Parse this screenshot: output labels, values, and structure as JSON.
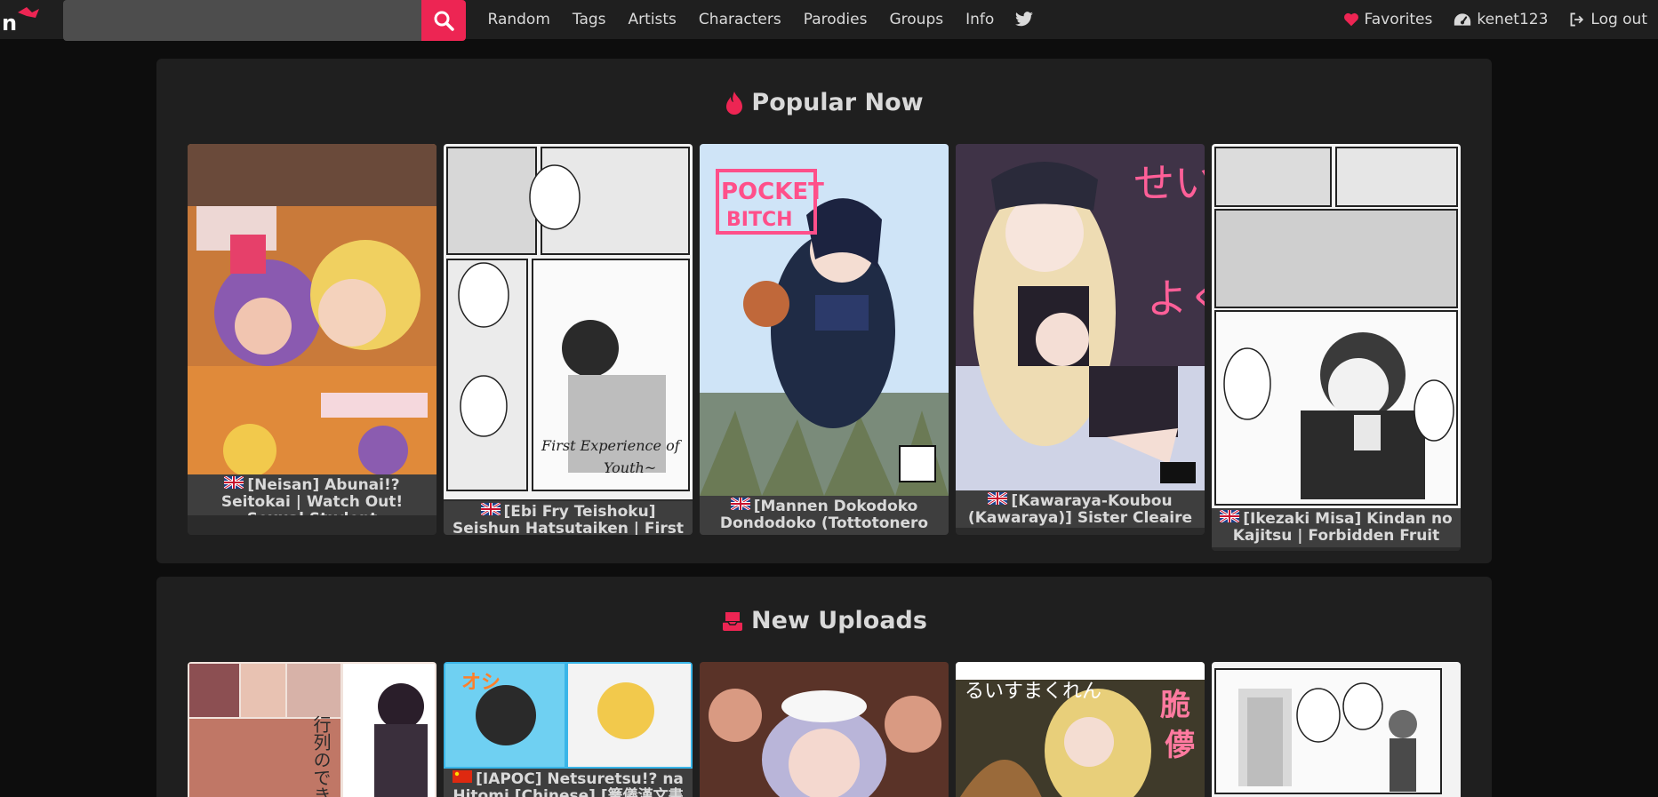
{
  "nav": {
    "logo_letter": "n",
    "search": {
      "value": "",
      "placeholder": ""
    },
    "links": [
      {
        "label": "Random"
      },
      {
        "label": "Tags"
      },
      {
        "label": "Artists"
      },
      {
        "label": "Characters"
      },
      {
        "label": "Parodies"
      },
      {
        "label": "Groups"
      },
      {
        "label": "Info"
      }
    ],
    "favorites_label": "Favorites",
    "username": "kenet123",
    "logout_label": "Log out"
  },
  "popular": {
    "title": "Popular Now",
    "galleries": [
      {
        "caption": "[Neisan] Abunai!? Seitokai | Watch Out! Sexual Student",
        "flag": "uk"
      },
      {
        "caption": "[Ebi Fry Teishoku] Seishun Hatsutaiken | First Experience",
        "flag": "uk"
      },
      {
        "caption": "[Mannen Dokodoko Dondodoko (Tottotonero",
        "flag": "uk"
      },
      {
        "caption": "[Kawaraya-Koubou (Kawaraya)] Sister Cleaire no",
        "flag": "uk"
      },
      {
        "caption": "[Ikezaki Misa] Kindan no Kajitsu | Forbidden Fruit",
        "flag": "uk"
      }
    ]
  },
  "uploads": {
    "title": "New Uploads",
    "galleries": [
      {
        "caption": ""
      },
      {
        "caption": "[IAPOC] Netsuretsu!? na Hitomi [Chinese] [篝儀漢文書坊",
        "flag": "cn"
      },
      {
        "caption": ""
      },
      {
        "caption": ""
      },
      {
        "caption": ""
      }
    ]
  },
  "colors": {
    "accent": "#ed2553",
    "nav_bg": "#1f1f1f",
    "page_bg": "#0d0d0d"
  }
}
